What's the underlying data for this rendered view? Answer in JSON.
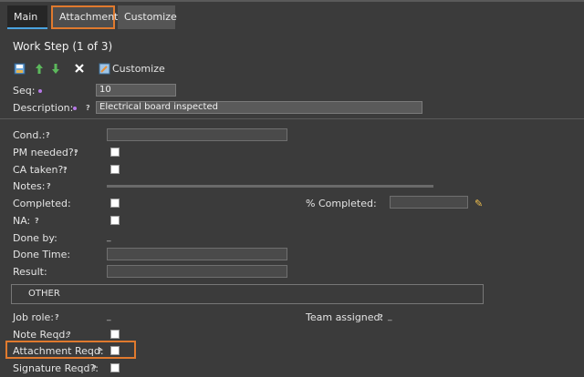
{
  "tabs": {
    "main": "Main",
    "attachment": "Attachment",
    "customize": "Customize"
  },
  "title": "Work Step (1 of 3)",
  "toolbar": {
    "customize_label": "Customize",
    "icons": [
      "save-icon",
      "arrow-up-icon",
      "arrow-down-icon",
      "delete-icon",
      "customize-icon"
    ]
  },
  "form": {
    "seq_label": "Seq:",
    "seq_value": "10",
    "description_label": "Description:",
    "description_value": "Electrical board inspected",
    "cond_label": "Cond.:",
    "pm_label": "PM needed?:",
    "ca_label": "CA taken?:",
    "notes_label": "Notes:",
    "completed_label": "Completed:",
    "pct_label": "% Completed:",
    "na_label": "NA:",
    "doneby_label": "Done by:",
    "doneby_value": "_",
    "donetime_label": "Done Time:",
    "result_label": "Result:",
    "section_label": "OTHER",
    "jobrole_label": "Job role:",
    "jobrole_value": "_",
    "team_label": "Team assigned:",
    "team_value": "_",
    "notereqd_label": "Note Reqd:",
    "attachreqd_label": "Attachment Reqd:",
    "sigreqd_label": "Signature Reqd?:"
  },
  "help_glyph": "?"
}
